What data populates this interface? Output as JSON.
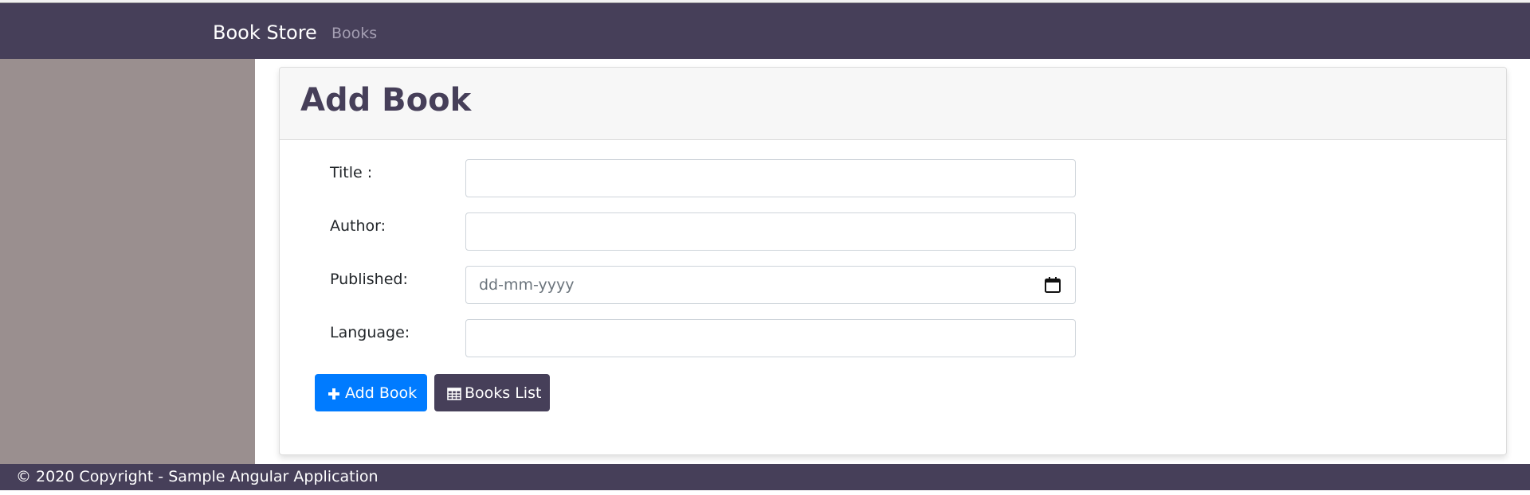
{
  "navbar": {
    "brand": "Book Store",
    "links": [
      {
        "label": "Books"
      }
    ]
  },
  "card": {
    "title": "Add Book"
  },
  "form": {
    "fields": [
      {
        "label": "Title :",
        "value": ""
      },
      {
        "label": "Author:",
        "value": ""
      },
      {
        "label": "Published:",
        "placeholder": "dd-mm-yyyy",
        "value": ""
      },
      {
        "label": "Language:",
        "value": ""
      }
    ]
  },
  "buttons": {
    "add": {
      "label": "Add Book",
      "icon": "plus-icon"
    },
    "list": {
      "label": "Books List",
      "icon": "table-icon"
    }
  },
  "footer": {
    "text": "© 2020 Copyright - Sample Angular Application"
  },
  "colors": {
    "navbar": "#463f59",
    "sidebar": "#9a8f8f",
    "primary": "#007bff"
  }
}
